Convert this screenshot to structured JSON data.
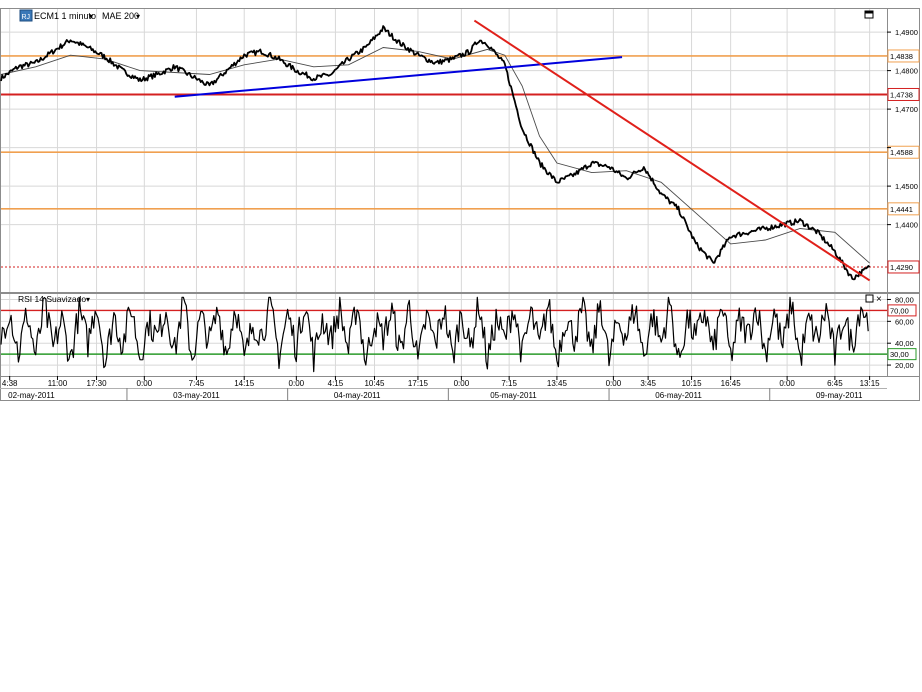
{
  "toolbar": {
    "symbol": "ECM1 1 minuto",
    "indicator": "MAE 200",
    "dropdown_glyph": "▾",
    "symbol_icon": "chart-symbol-icon",
    "maximize_icon": "maximize-icon",
    "close_icon": "close-icon"
  },
  "rsi_panel": {
    "title": "RSI 14 Suavizado"
  },
  "colors": {
    "price": "#000000",
    "ma": "#4a4a4a",
    "support_line": "#0000dd",
    "resistance_line": "#e0201a",
    "orange_level": "#f0a050",
    "red_level": "#d42020",
    "rsi_overbought": "#d42020",
    "rsi_oversold": "#2a9a2a",
    "grid": "#d8d8d8"
  },
  "chart_data": [
    {
      "type": "line",
      "panel": "price",
      "series": [
        {
          "name": "ECM1 1 minuto",
          "x": [
            0,
            4,
            8,
            12,
            16,
            20,
            24,
            28,
            32,
            36,
            40,
            44,
            48,
            52,
            56,
            60,
            64,
            68,
            72,
            76,
            80,
            84,
            88,
            92,
            96,
            100,
            104,
            108,
            110,
            112,
            116,
            120,
            124,
            128,
            132,
            136,
            140,
            144,
            148,
            152,
            156,
            160,
            164,
            168,
            172,
            176,
            180,
            184,
            188,
            192,
            196,
            200
          ],
          "values": [
            1.478,
            1.481,
            1.482,
            1.485,
            1.488,
            1.486,
            1.4835,
            1.48,
            1.4775,
            1.479,
            1.481,
            1.4785,
            1.476,
            1.48,
            1.484,
            1.485,
            1.483,
            1.48,
            1.478,
            1.479,
            1.483,
            1.486,
            1.491,
            1.487,
            1.484,
            1.482,
            1.483,
            1.485,
            1.488,
            1.487,
            1.4815,
            1.465,
            1.456,
            1.451,
            1.453,
            1.456,
            1.455,
            1.452,
            1.455,
            1.448,
            1.444,
            1.435,
            1.43,
            1.437,
            1.438,
            1.439,
            1.44,
            1.441,
            1.438,
            1.433,
            1.426,
            1.429
          ]
        },
        {
          "name": "MAE 200",
          "x": [
            0,
            8,
            16,
            24,
            32,
            40,
            48,
            56,
            64,
            72,
            80,
            88,
            96,
            104,
            112,
            116,
            120,
            124,
            128,
            136,
            144,
            152,
            160,
            168,
            176,
            184,
            192,
            200
          ],
          "values": [
            1.479,
            1.481,
            1.484,
            1.483,
            1.48,
            1.4795,
            1.479,
            1.4815,
            1.483,
            1.481,
            1.4815,
            1.486,
            1.485,
            1.483,
            1.4855,
            1.484,
            1.476,
            1.463,
            1.456,
            1.4535,
            1.454,
            1.451,
            1.443,
            1.435,
            1.436,
            1.439,
            1.438,
            1.43
          ]
        }
      ],
      "horizontal_levels": [
        {
          "value": 1.4838,
          "label": "1,4838",
          "color": "orange"
        },
        {
          "value": 1.4738,
          "label": "1,4738",
          "color": "red"
        },
        {
          "value": 1.4588,
          "label": "1,4588",
          "color": "orange"
        },
        {
          "value": 1.4441,
          "label": "1,4441",
          "color": "orange"
        },
        {
          "value": 1.429,
          "label": "1,4290",
          "color": "red-dotted"
        }
      ],
      "trendlines": [
        {
          "kind": "support",
          "from": {
            "x": 40,
            "y": 1.4732
          },
          "to": {
            "x": 143,
            "y": 1.4835
          }
        },
        {
          "kind": "resistance",
          "from": {
            "x": 109,
            "y": 1.493
          },
          "to": {
            "x": 200,
            "y": 1.4255
          }
        }
      ],
      "y_ticks": [
        "1,4900",
        "1,4800",
        "1,4700",
        "1,4600",
        "1,4500",
        "1,4400"
      ],
      "y_tick_values": [
        1.49,
        1.48,
        1.47,
        1.46,
        1.45,
        1.44
      ],
      "ylim": [
        1.4225,
        1.496
      ],
      "xlim": [
        0,
        204
      ],
      "grid": true
    },
    {
      "type": "line",
      "panel": "rsi",
      "series": [
        {
          "name": "RSI 14 Suavizado",
          "x": [
            0,
            2,
            4,
            6,
            8,
            10,
            12,
            14,
            16,
            18,
            20,
            22,
            24,
            26,
            28,
            30,
            32,
            34,
            36,
            38,
            40,
            42,
            44,
            46,
            48,
            50,
            52,
            54,
            56,
            58,
            60,
            62,
            64,
            66,
            68,
            70,
            72,
            74,
            76,
            78,
            80,
            82,
            84,
            86,
            88,
            90,
            92,
            94,
            96,
            98,
            100,
            102,
            104,
            106,
            108,
            110,
            112,
            114,
            116,
            118,
            120,
            122,
            124,
            126,
            128,
            130,
            132,
            134,
            136,
            138,
            140,
            142,
            144,
            146,
            148,
            150,
            152,
            154,
            156,
            158,
            160,
            162,
            164,
            166,
            168,
            170,
            172,
            174,
            176,
            178,
            180,
            182,
            184,
            186,
            188,
            190,
            192,
            194,
            196,
            198,
            200
          ],
          "values": [
            45,
            72,
            30,
            68,
            28,
            75,
            35,
            62,
            25,
            70,
            40,
            78,
            22,
            66,
            38,
            74,
            28,
            60,
            45,
            72,
            32,
            80,
            26,
            64,
            42,
            70,
            30,
            76,
            24,
            58,
            48,
            73,
            29,
            67,
            36,
            79,
            27,
            63,
            44,
            71,
            33,
            77,
            23,
            61,
            46,
            69,
            31,
            75,
            21,
            65,
            39,
            72,
            26,
            70,
            34,
            78,
            24,
            62,
            43,
            74,
            29,
            68,
            37,
            76,
            25,
            64,
            45,
            71,
            30,
            79,
            23,
            60,
            47,
            73,
            28,
            66,
            40,
            77,
            22,
            63,
            44,
            70,
            32,
            75,
            27,
            61,
            48,
            74,
            30,
            69,
            36,
            78,
            25,
            62,
            42,
            72,
            28,
            65,
            38,
            76,
            55
          ]
        }
      ],
      "levels": [
        {
          "value": 70,
          "label": "70,00",
          "color": "red"
        },
        {
          "value": 30,
          "label": "30,00",
          "color": "green"
        }
      ],
      "y_ticks": [
        "80,00",
        "60,00",
        "40,00",
        "20,00"
      ],
      "y_tick_values": [
        80,
        60,
        40,
        20
      ],
      "ylim": [
        10,
        85
      ],
      "xlim": [
        0,
        204
      ],
      "grid": true
    }
  ],
  "time_axis": {
    "ticks": [
      {
        "x": 2,
        "label": "4:38"
      },
      {
        "x": 13,
        "label": "11:00"
      },
      {
        "x": 22,
        "label": "17:30"
      },
      {
        "x": 33,
        "label": "0:00"
      },
      {
        "x": 45,
        "label": "7:45"
      },
      {
        "x": 56,
        "label": "14:15"
      },
      {
        "x": 68,
        "label": "0:00"
      },
      {
        "x": 77,
        "label": "4:15"
      },
      {
        "x": 86,
        "label": "10:45"
      },
      {
        "x": 96,
        "label": "17:15"
      },
      {
        "x": 106,
        "label": "0:00"
      },
      {
        "x": 117,
        "label": "7:15"
      },
      {
        "x": 128,
        "label": "13:45"
      },
      {
        "x": 141,
        "label": "0:00"
      },
      {
        "x": 149,
        "label": "3:45"
      },
      {
        "x": 159,
        "label": "10:15"
      },
      {
        "x": 168,
        "label": "16:45"
      },
      {
        "x": 181,
        "label": "0:00"
      },
      {
        "x": 192,
        "label": "6:45"
      },
      {
        "x": 200,
        "label": "13:15"
      }
    ],
    "dates": [
      {
        "x": 7,
        "label": "02-may-2011"
      },
      {
        "x": 45,
        "label": "03-may-2011"
      },
      {
        "x": 82,
        "label": "04-may-2011"
      },
      {
        "x": 118,
        "label": "05-may-2011"
      },
      {
        "x": 156,
        "label": "06-may-2011"
      },
      {
        "x": 193,
        "label": "09-may-2011"
      }
    ],
    "date_separators": [
      29,
      66,
      103,
      140,
      177
    ]
  }
}
